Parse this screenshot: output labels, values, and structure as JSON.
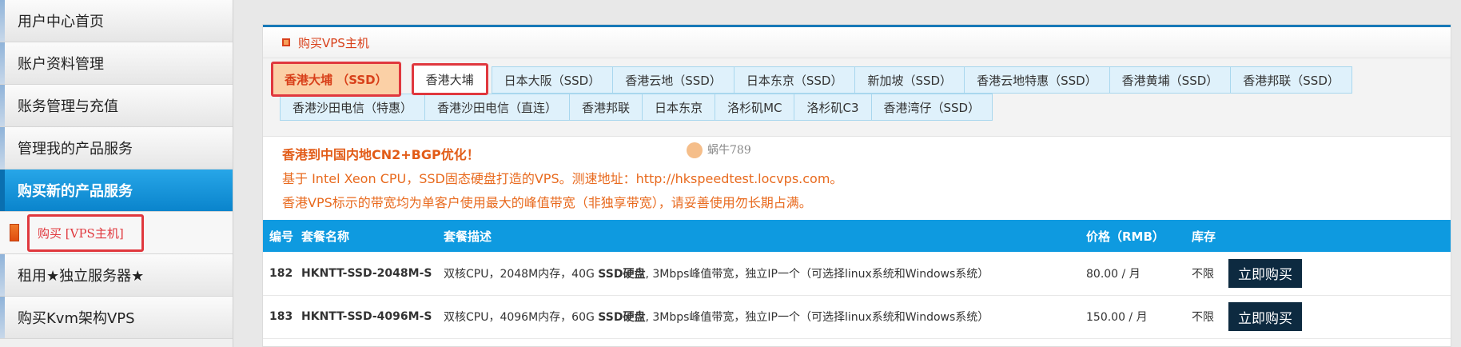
{
  "sidebar": {
    "items": [
      {
        "label": "用户中心首页"
      },
      {
        "label": "账户资料管理"
      },
      {
        "label": "账务管理与充值"
      },
      {
        "label": "管理我的产品服务"
      },
      {
        "label": "购买新的产品服务"
      }
    ],
    "sub_item": {
      "label": "购买 [VPS主机]"
    },
    "items_after": [
      {
        "label": "租用★独立服务器★"
      },
      {
        "label": "购买Kvm架构VPS"
      }
    ]
  },
  "panel": {
    "title": "购买VPS主机"
  },
  "tabs_row1": [
    {
      "label": "香港大埔 （SSD）"
    },
    {
      "label": "香港大埔"
    },
    {
      "label": "日本大阪（SSD）"
    },
    {
      "label": "香港云地（SSD）"
    },
    {
      "label": "日本东京（SSD）"
    },
    {
      "label": "新加坡（SSD）"
    },
    {
      "label": "香港云地特惠（SSD）"
    },
    {
      "label": "香港黄埔（SSD）"
    },
    {
      "label": "香港邦联（SSD）"
    }
  ],
  "tabs_row2": [
    {
      "label": "香港沙田电信（特惠）"
    },
    {
      "label": "香港沙田电信（直连）"
    },
    {
      "label": "香港邦联"
    },
    {
      "label": "日本东京"
    },
    {
      "label": "洛杉矶MC"
    },
    {
      "label": "洛杉矶C3"
    },
    {
      "label": "香港湾仔（SSD）"
    }
  ],
  "notes": {
    "line1": "香港到中国内地CN2+BGP优化！",
    "line2": "基于 Intel Xeon CPU，SSD固态硬盘打造的VPS。测速地址：http://hkspeedtest.locvps.com。",
    "line3": "香港VPS标示的带宽均为单客户使用最大的峰值带宽（非独享带宽），请妥善使用勿长期占满。"
  },
  "watermark": "蜗牛789",
  "table": {
    "headers": {
      "code": "编号",
      "name": "套餐名称",
      "desc": "套餐描述",
      "price": "价格（RMB）",
      "stock": "库存"
    },
    "rows": [
      {
        "code": "182",
        "name": "HKNTT-SSD-2048M-S",
        "desc_pre": "双核CPU，2048M内存，40G ",
        "desc_bold": "SSD硬盘",
        "desc_post": ", 3Mbps峰值带宽，独立IP一个（可选择linux系统和Windows系统）",
        "price": "80.00 / 月",
        "stock": "不限",
        "buy_label": "立即购买"
      },
      {
        "code": "183",
        "name": "HKNTT-SSD-4096M-S",
        "desc_pre": "双核CPU，4096M内存，60G ",
        "desc_bold": "SSD硬盘",
        "desc_post": ", 3Mbps峰值带宽，独立IP一个（可选择linux系统和Windows系统）",
        "price": "150.00 / 月",
        "stock": "不限",
        "buy_label": "立即购买"
      }
    ]
  },
  "colors": {
    "accent_blue": "#0e9ae0",
    "accent_orange": "#e86a1e",
    "highlight_red": "#e0383e"
  }
}
